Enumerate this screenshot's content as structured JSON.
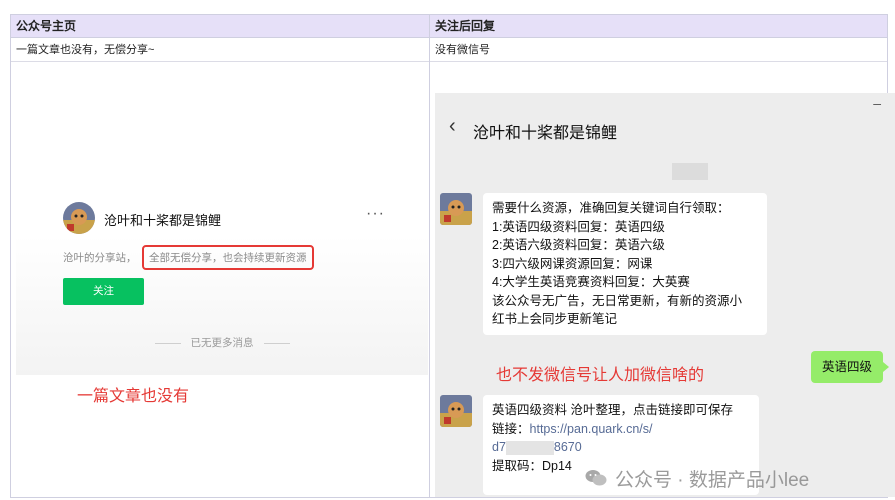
{
  "table": {
    "header": [
      "公众号主页",
      "关注后回复"
    ],
    "row": [
      "一篇文章也没有，无偿分享~",
      "没有微信号"
    ]
  },
  "left": {
    "account_name": "沧叶和十桨都是锦鲤",
    "more": "···",
    "share_prefix": "沧叶的分享站，",
    "share_highlight": "全部无偿分享，也会持续更新资源",
    "follow_label": "关注",
    "no_more": "已无更多消息",
    "annotation": "一篇文章也没有"
  },
  "chat": {
    "minimize": "–",
    "back": "‹",
    "title": "沧叶和十桨都是锦鲤",
    "message1": [
      "需要什么资源，准确回复关键词自行领取：",
      "1:英语四级资料回复：英语四级",
      "2:英语六级资料回复：英语六级",
      "3:四六级网课资源回复：网课",
      "4:大学生英语竞赛资料回复：大英赛",
      "该公众号无广告，无日常更新，有新的资源小",
      "红书上会同步更新笔记"
    ],
    "user_reply": "英语四级",
    "annotation": "也不发微信号让人加微信啥的",
    "message2": {
      "line1": "英语四级资料 沧叶整理，点击链接即可保存",
      "link_label": "链接：",
      "link_url": "https://pan.quark.cn/s/",
      "link_code_start": "d7",
      "link_code_end": "8670",
      "code": "提取码：Dp14"
    }
  },
  "watermark": "公众号 · 数据产品小lee",
  "colors": {
    "header_bg": "#e6e0f8",
    "wechat_green": "#07c160",
    "bubble_green": "#95ec69",
    "annotation_red": "#e53935",
    "link": "#576b95"
  }
}
